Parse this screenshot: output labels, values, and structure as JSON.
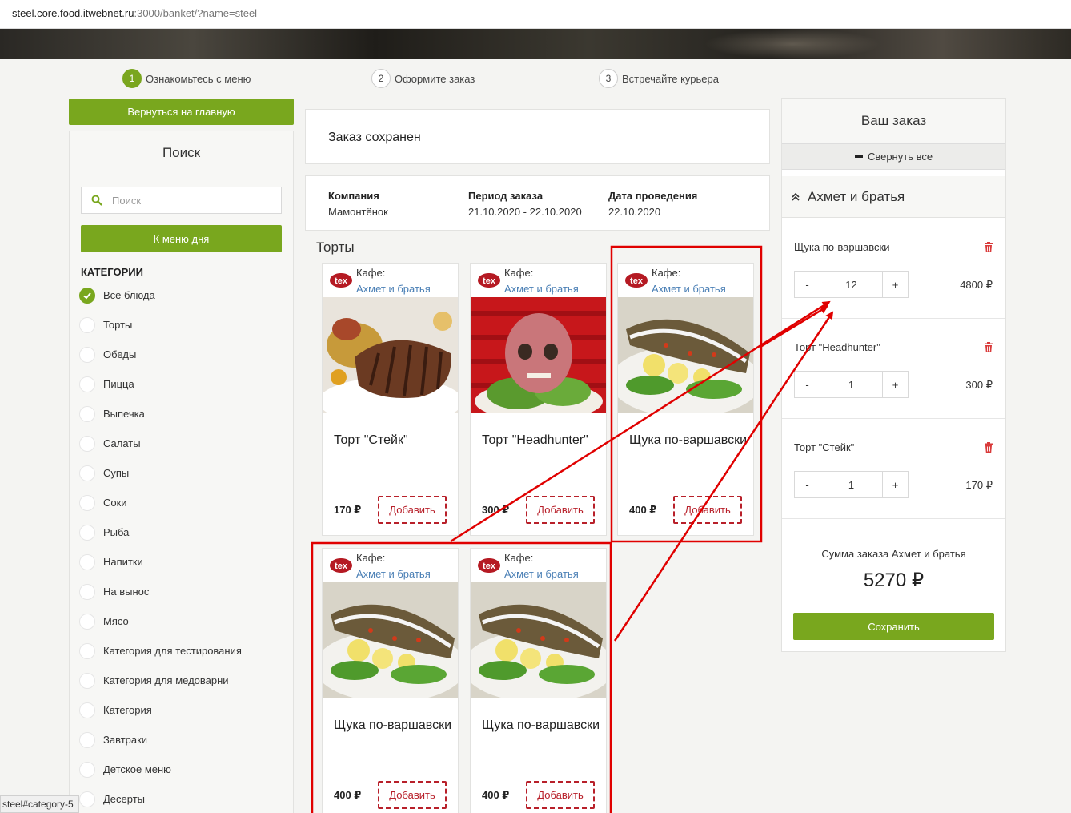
{
  "browser": {
    "url_host": "steel.core.food.itwebnet.ru",
    "url_rest": ":3000/banket/?name=steel",
    "status_text": "steel#category-5"
  },
  "steps": [
    {
      "num": "1",
      "label": "Ознакомьтесь с меню",
      "active": true
    },
    {
      "num": "2",
      "label": "Оформите заказ",
      "active": false
    },
    {
      "num": "3",
      "label": "Встречайте курьера",
      "active": false
    }
  ],
  "sidebar": {
    "back_label": "Вернуться на главную",
    "search_title": "Поиск",
    "search_placeholder": "Поиск",
    "menu_day_label": "К меню дня",
    "categories_title": "КАТЕГОРИИ",
    "categories": [
      {
        "label": "Все блюда",
        "selected": true
      },
      {
        "label": "Торты",
        "selected": false
      },
      {
        "label": "Обеды",
        "selected": false
      },
      {
        "label": "Пицца",
        "selected": false
      },
      {
        "label": "Выпечка",
        "selected": false
      },
      {
        "label": "Салаты",
        "selected": false
      },
      {
        "label": "Супы",
        "selected": false
      },
      {
        "label": "Соки",
        "selected": false
      },
      {
        "label": "Рыба",
        "selected": false
      },
      {
        "label": "Напитки",
        "selected": false
      },
      {
        "label": "На вынос",
        "selected": false
      },
      {
        "label": "Мясо",
        "selected": false
      },
      {
        "label": "Категория для тестирования",
        "selected": false
      },
      {
        "label": "Категория для медоварни",
        "selected": false
      },
      {
        "label": "Категория",
        "selected": false
      },
      {
        "label": "Завтраки",
        "selected": false
      },
      {
        "label": "Детское меню",
        "selected": false
      },
      {
        "label": "Десерты",
        "selected": false
      }
    ]
  },
  "main": {
    "saved_text": "Заказ сохранен",
    "info": {
      "company_label": "Компания",
      "company_value": "Мамонтёнок",
      "period_label": "Период заказа",
      "period_value": "21.10.2020 - 22.10.2020",
      "date_label": "Дата проведения",
      "date_value": "22.10.2020"
    },
    "section_title": "Торты",
    "cards": [
      {
        "cafe_label": "Кафе:",
        "cafe_name": "Ахмет и братья",
        "image": "steak",
        "name": "Торт \"Стейк\"",
        "price": "170 ₽",
        "add_label": "Добавить"
      },
      {
        "cafe_label": "Кафе:",
        "cafe_name": "Ахмет и братья",
        "image": "skull",
        "name": "Торт \"Headhunter\"",
        "price": "300 ₽",
        "add_label": "Добавить"
      },
      {
        "cafe_label": "Кафе:",
        "cafe_name": "Ахмет и братья",
        "image": "fish",
        "name": "Щука по-варшавски",
        "price": "400 ₽",
        "add_label": "Добавить"
      },
      {
        "cafe_label": "Кафе:",
        "cafe_name": "Ахмет и братья",
        "image": "fish",
        "name": "Щука по-варшавски",
        "price": "400 ₽",
        "add_label": "Добавить"
      },
      {
        "cafe_label": "Кафе:",
        "cafe_name": "Ахмет и братья",
        "image": "fish",
        "name": "Щука по-варшавски",
        "price": "400 ₽",
        "add_label": "Добавить"
      }
    ]
  },
  "order": {
    "title": "Ваш заказ",
    "collapse_label": "Свернуть все",
    "group_name": "Ахмет и братья",
    "items": [
      {
        "name": "Щука по-варшавски",
        "qty": "12",
        "price": "4800 ₽",
        "minus": "-",
        "plus": "+"
      },
      {
        "name": "Торт \"Headhunter\"",
        "qty": "1",
        "price": "300 ₽",
        "minus": "-",
        "plus": "+"
      },
      {
        "name": "Торт \"Стейк\"",
        "qty": "1",
        "price": "170 ₽",
        "minus": "-",
        "plus": "+"
      }
    ],
    "sum_label": "Сумма заказа Ахмет и братья",
    "sum_value": "5270 ₽",
    "save_label": "Сохранить"
  },
  "colors": {
    "accent_green": "#79a71e",
    "add_red": "#b8202a",
    "annotation_red": "#e00000",
    "link_blue": "#4a7fb5"
  }
}
